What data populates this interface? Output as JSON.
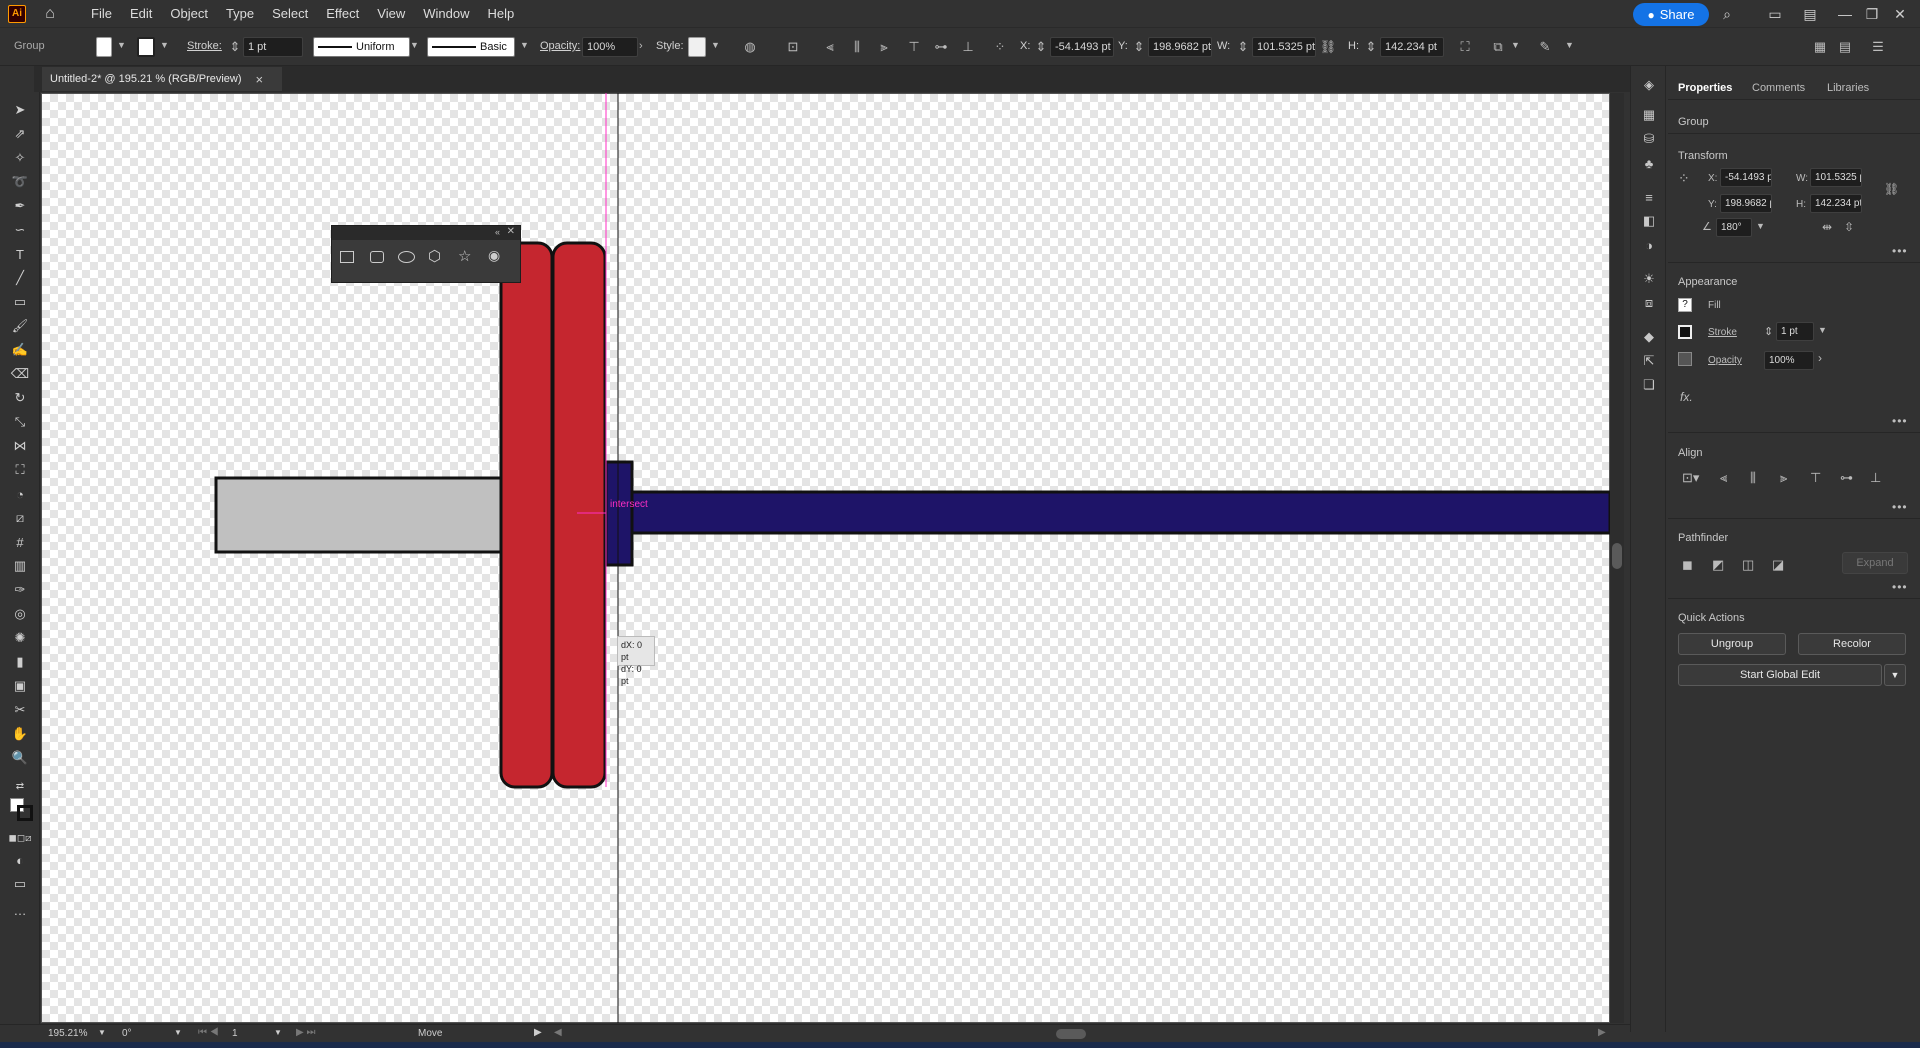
{
  "menubar": {
    "app_logo": "Ai",
    "items": [
      "File",
      "Edit",
      "Object",
      "Type",
      "Select",
      "Effect",
      "View",
      "Window",
      "Help"
    ],
    "share_label": "Share"
  },
  "controlbar": {
    "selection_type": "Group",
    "stroke_label": "Stroke:",
    "stroke_value": "1 pt",
    "stroke_profile": "Uniform",
    "brush": "Basic",
    "opacity_label": "Opacity:",
    "opacity_value": "100%",
    "style_label": "Style:",
    "x_label": "X:",
    "x_value": "-54.1493 pt",
    "y_label": "Y:",
    "y_value": "198.9682 pt",
    "w_label": "W:",
    "w_value": "101.5325 pt",
    "h_label": "H:",
    "h_value": "142.234 pt"
  },
  "document_tab": {
    "title": "Untitled-2* @ 195.21 % (RGB/Preview)",
    "close": "×"
  },
  "canvas": {
    "smart_guide_label": "intersect",
    "move_readout_dx": "dX: 0 pt",
    "move_readout_dy": "dY: 0 pt",
    "colors": {
      "handle_fill": "#c0c0c0",
      "plate_fill": "#c5262f",
      "bar_fill": "#1e1468",
      "outline": "#111111",
      "guide": "#ff2ec4"
    }
  },
  "properties": {
    "tabs": [
      "Properties",
      "Comments",
      "Libraries"
    ],
    "selection_type": "Group",
    "transform_title": "Transform",
    "x_label": "X:",
    "x_value": "-54.1493 pt",
    "y_label": "Y:",
    "y_value": "198.9682 pt",
    "w_label": "W:",
    "w_value": "101.5325 p",
    "h_label": "H:",
    "h_value": "142.234 pt",
    "angle_value": "180°",
    "appearance_title": "Appearance",
    "fill_label": "Fill",
    "stroke_label": "Stroke",
    "stroke_value": "1 pt",
    "opacity_label": "Opacity",
    "opacity_value": "100%",
    "fx_label": "fx.",
    "align_title": "Align",
    "pathfinder_title": "Pathfinder",
    "expand_label": "Expand",
    "quick_actions_title": "Quick Actions",
    "ungroup_label": "Ungroup",
    "recolor_label": "Recolor",
    "global_edit_label": "Start Global Edit"
  },
  "statusbar": {
    "zoom": "195.21%",
    "rotation": "0°",
    "artboard_num": "1",
    "tool_name": "Move"
  }
}
